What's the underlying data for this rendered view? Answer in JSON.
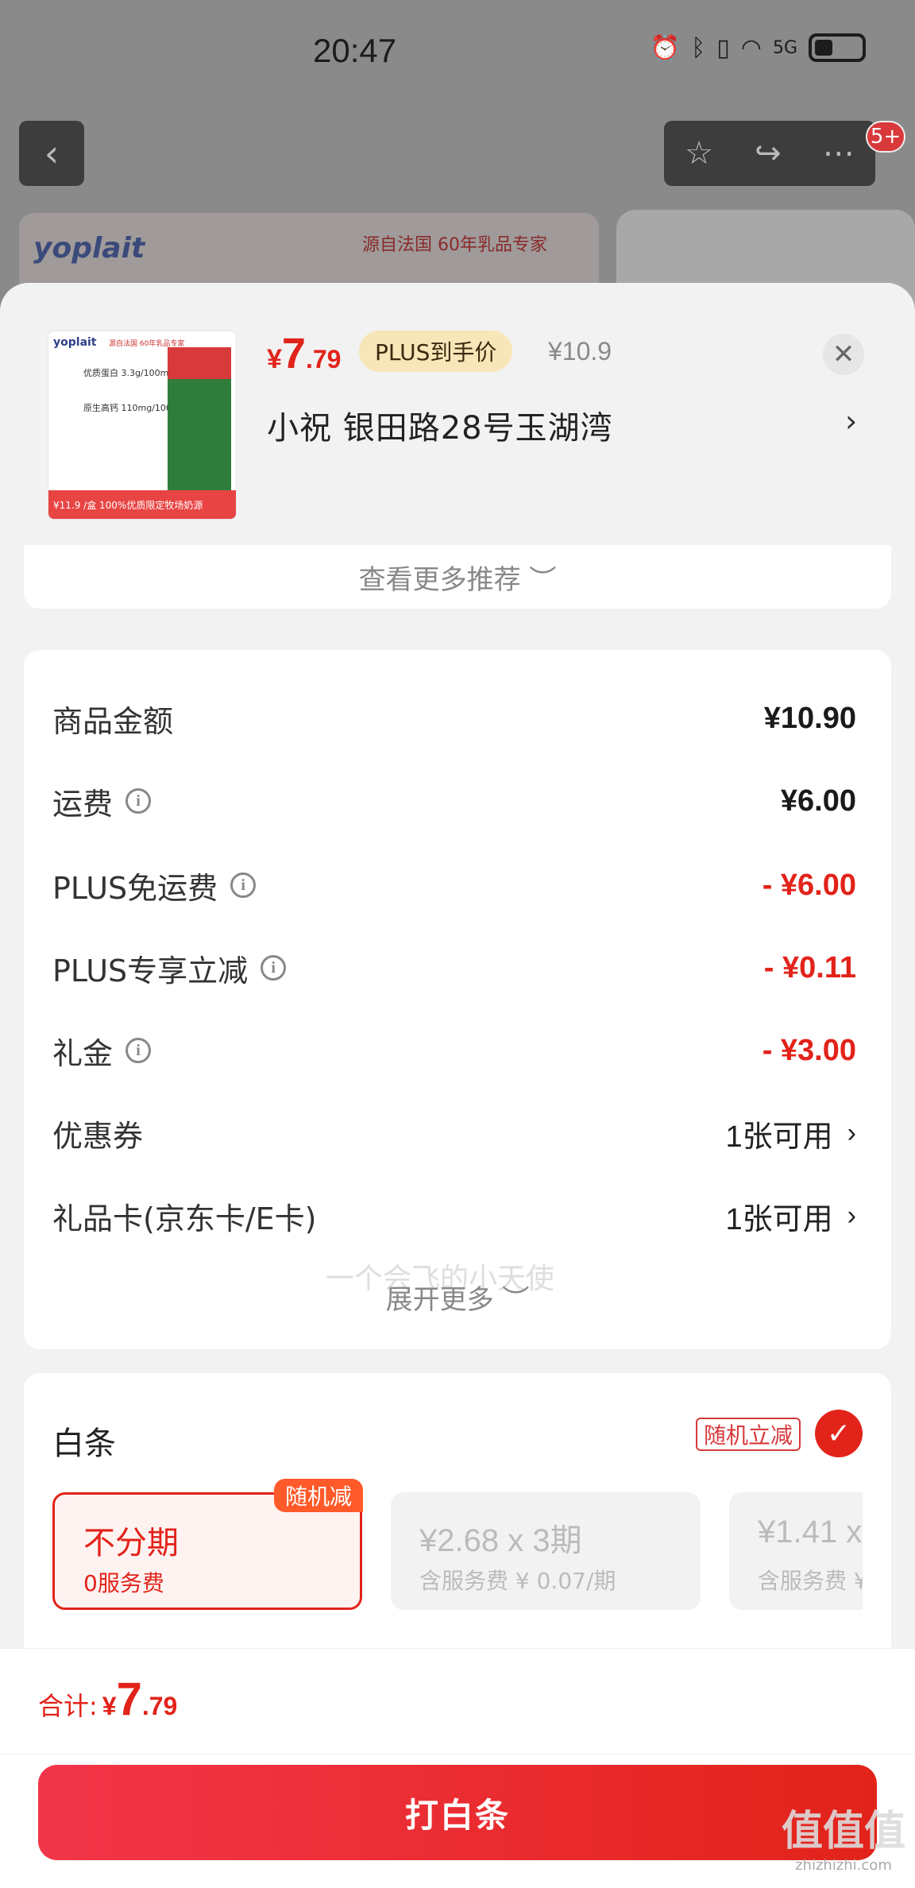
{
  "status_bar": {
    "time": "20:47",
    "network": "5G"
  },
  "nav": {
    "badge": "5+"
  },
  "background": {
    "brand": "yoplait",
    "slogan": "源自法国  60年乳品专家"
  },
  "product": {
    "price_yen": "¥",
    "price_int": "7",
    "price_dec": ".79",
    "plus_tag": "PLUS到手价",
    "original_price": "¥10.9",
    "address": "小祝  银田路28号玉湖湾",
    "thumb_brand": "yoplait",
    "thumb_top": "源自法国 60年乳品专家",
    "thumb_line1": "优质蛋白 3.3g/100ml",
    "thumb_line2": "原生高钙 110mg/100ml",
    "thumb_foot": "¥11.9 /盒  100%优质限定牧场奶源"
  },
  "recommend": {
    "label": "查看更多推荐 ︶"
  },
  "amounts": {
    "rows": [
      {
        "label": "商品金额",
        "value": "¥10.90"
      },
      {
        "label": "运费",
        "value": "¥6.00"
      },
      {
        "label": "PLUS免运费",
        "value": "- ¥6.00"
      },
      {
        "label": "PLUS专享立减",
        "value": "- ¥0.11"
      },
      {
        "label": "礼金",
        "value": "- ¥3.00"
      },
      {
        "label": "优惠券",
        "value": "1张可用"
      },
      {
        "label": "礼品卡(京东卡/E卡)",
        "value": "1张可用"
      }
    ],
    "expand_more": "展开更多 ︶",
    "watermark": "一个会飞的小天使"
  },
  "baitiao": {
    "title": "白条",
    "random_tag": "随机立减",
    "plans": [
      {
        "title": "不分期",
        "sub": "0服务费",
        "badge": "随机减"
      },
      {
        "title": "¥2.68 x 3期",
        "sub": "含服务费 ¥ 0.07/期"
      },
      {
        "title": "¥1.41 x",
        "sub": "含服务费 ¥"
      }
    ]
  },
  "footer": {
    "total_label": "合计:",
    "total_yen": "¥",
    "total_int": "7",
    "total_dec": ".79",
    "pay_button": "打白条"
  },
  "site_mark": {
    "big": "值值值",
    "small": "zhizhizhi.com"
  },
  "colors": {
    "accent_red": "#e2231a",
    "plus_gold": "#f7e6b8"
  }
}
